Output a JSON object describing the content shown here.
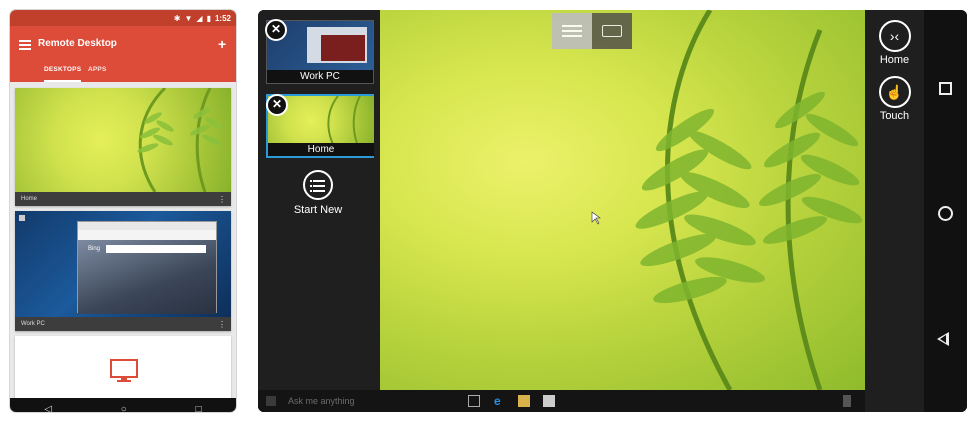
{
  "left_phone": {
    "status_time": "1:52",
    "app_title": "Remote Desktop",
    "add_label": "+",
    "tabs": [
      {
        "label": "DESKTOPS",
        "active": true
      },
      {
        "label": "APPS",
        "active": false
      }
    ],
    "cards": [
      {
        "name": "Home"
      },
      {
        "name": "Work PC"
      }
    ],
    "browser_search": "Bing",
    "more_label": "⋮",
    "accent_color": "#dd4b39"
  },
  "right_phone": {
    "sessions": [
      {
        "label": "Work PC",
        "active": false
      },
      {
        "label": "Home",
        "active": true
      }
    ],
    "close_label": "✕",
    "start_new_label": "Start New",
    "home_label": "Home",
    "touch_label": "Touch",
    "taskbar_search_placeholder": "Ask me anything",
    "icons": [
      "hamburger-icon",
      "keyboard-icon",
      "home-arrows-icon",
      "touch-icon",
      "android-recents-icon",
      "android-home-icon",
      "android-back-icon"
    ]
  }
}
